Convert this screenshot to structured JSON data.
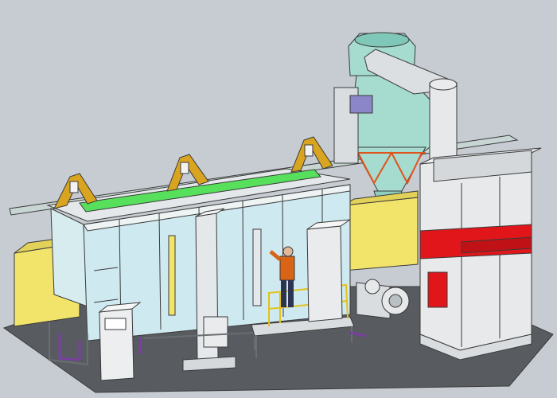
{
  "scene": {
    "description_visible_text": [],
    "colors": {
      "background": "#c7ccd3",
      "booth_glass": "#cfe9f1",
      "cyclone": "#a6dcd0",
      "yellow_panel": "#f2e36b",
      "gold_frame": "#d9a520",
      "green_duct": "#57e05c",
      "red_panel": "#e0161b",
      "floor": "#585c61",
      "purple_frame": "#7a3fa0",
      "worker_shirt": "#d96416",
      "worker_pants": "#2b3552"
    }
  }
}
